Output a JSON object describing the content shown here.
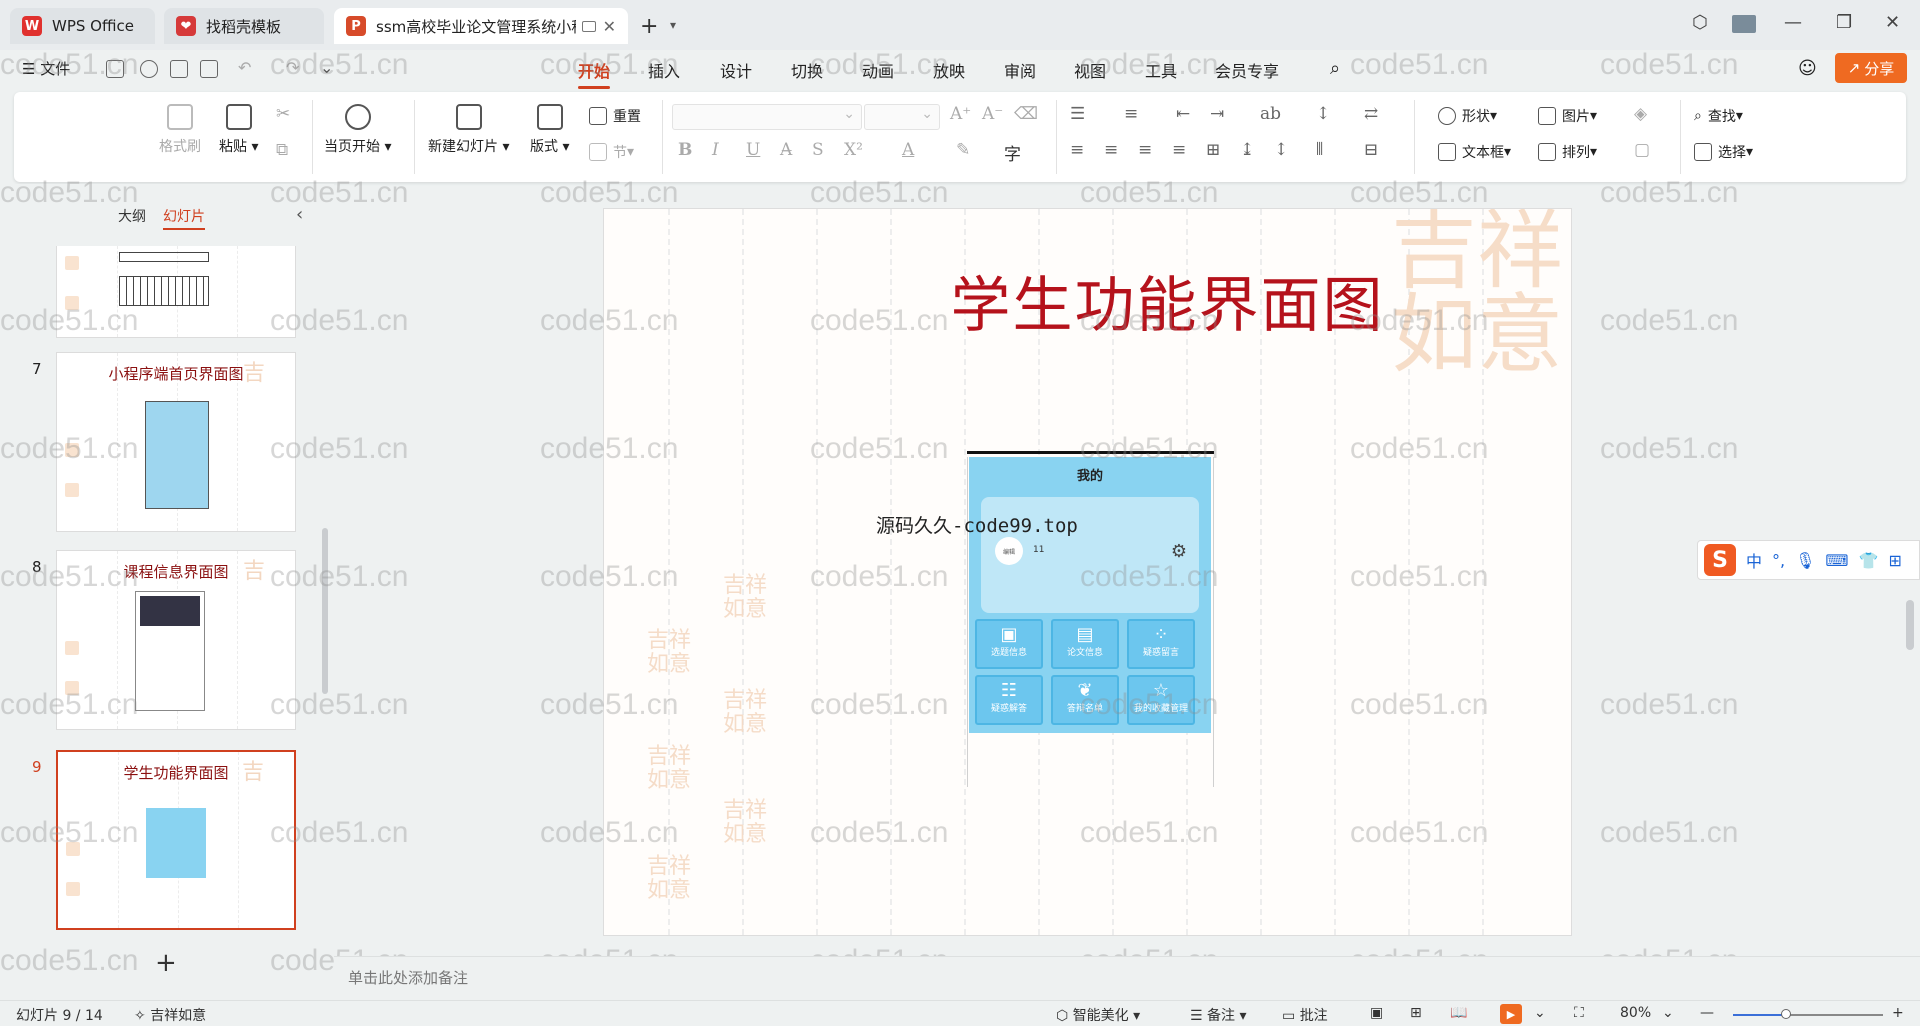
{
  "tabs": [
    {
      "label": "WPS Office",
      "icon": "wps-icon"
    },
    {
      "label": "找稻壳模板",
      "icon": "docer-icon"
    },
    {
      "label": "ssm高校毕业论文管理系统小程",
      "icon": "ppt-icon"
    }
  ],
  "menu": {
    "file": "文件",
    "items": [
      "开始",
      "插入",
      "设计",
      "切换",
      "动画",
      "放映",
      "审阅",
      "视图",
      "工具",
      "会员专享"
    ],
    "active": "开始",
    "share": "分享"
  },
  "ribbon": {
    "format_painter": "格式刷",
    "paste": "粘贴",
    "slideshow_from_current": "当页开始",
    "new_slide": "新建幻灯片",
    "layout": "版式",
    "reset": "重置",
    "section": "节",
    "shape": "形状",
    "picture": "图片",
    "textbox": "文本框",
    "arrange": "排列",
    "find": "查找",
    "select": "选择"
  },
  "left_panel": {
    "tab_outline": "大纲",
    "tab_slides": "幻灯片",
    "thumbnails": [
      {
        "number": "7",
        "title": "小程序端首页界面图"
      },
      {
        "number": "8",
        "title": "课程信息界面图"
      },
      {
        "number": "9",
        "title": "学生功能界面图",
        "selected": true
      }
    ]
  },
  "slide": {
    "title": "学生功能界面图",
    "caption": "源码久久-code99.top",
    "phone": {
      "header": "我的",
      "avatar_label": "编辑",
      "user_id": "11",
      "grid": [
        {
          "label": "选题信息",
          "icon": "grid-box-icon"
        },
        {
          "label": "论文信息",
          "icon": "doc-icon"
        },
        {
          "label": "疑惑留言",
          "icon": "apps-icon"
        },
        {
          "label": "疑惑解答",
          "icon": "list-icon"
        },
        {
          "label": "答辩名单",
          "icon": "leaf-icon"
        },
        {
          "label": "我的收藏管理",
          "icon": "star-icon"
        }
      ]
    }
  },
  "notes_placeholder": "单击此处添加备注",
  "status": {
    "slide_counter": "幻灯片 9 / 14",
    "theme": "吉祥如意",
    "beautify": "智能美化",
    "notes": "备注",
    "comments": "批注",
    "zoom": "80%",
    "zoom_fraction": 0.8
  },
  "watermark": "code51.cn",
  "ime": {
    "mode": "中"
  },
  "colors": {
    "accent": "#d0401f",
    "title_red": "#b5121b",
    "share_orange": "#ef6a21",
    "phone_blue": "#89d3f1"
  }
}
